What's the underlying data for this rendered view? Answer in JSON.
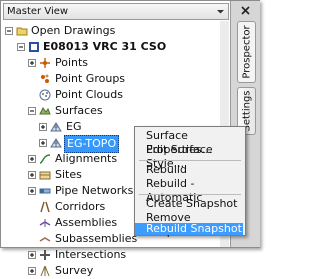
{
  "view_selector": {
    "label": "Master View"
  },
  "side_tabs": {
    "prospector": "Prospector",
    "settings": "Settings"
  },
  "tree": {
    "open_drawings": "Open Drawings",
    "drawing": "E08013 VRC 31 CSO",
    "points": "Points",
    "point_groups": "Point Groups",
    "point_clouds": "Point Clouds",
    "surfaces": "Surfaces",
    "eg": "EG",
    "eg_topo": "EG-TOPO",
    "alignments": "Alignments",
    "sites": "Sites",
    "pipe_networks": "Pipe Networks",
    "corridors": "Corridors",
    "assemblies": "Assemblies",
    "subassemblies": "Subassemblies",
    "intersections": "Intersections",
    "survey": "Survey"
  },
  "context_menu": {
    "surface_properties": "Surface Properties...",
    "edit_surface_style": "Edit Surface Style...",
    "rebuild": "Rebuild",
    "rebuild_automatic": "Rebuild - Automatic",
    "create_snapshot": "Create Snapshot",
    "remove_snapshot": "Remove Snapshot",
    "rebuild_snapshot": "Rebuild Snapshot"
  },
  "colors": {
    "selection": "#3399ff",
    "menu_highlight": "#3d9cff",
    "drawing_icon": "#2b4f9a",
    "point_icon": "#c85a00"
  }
}
